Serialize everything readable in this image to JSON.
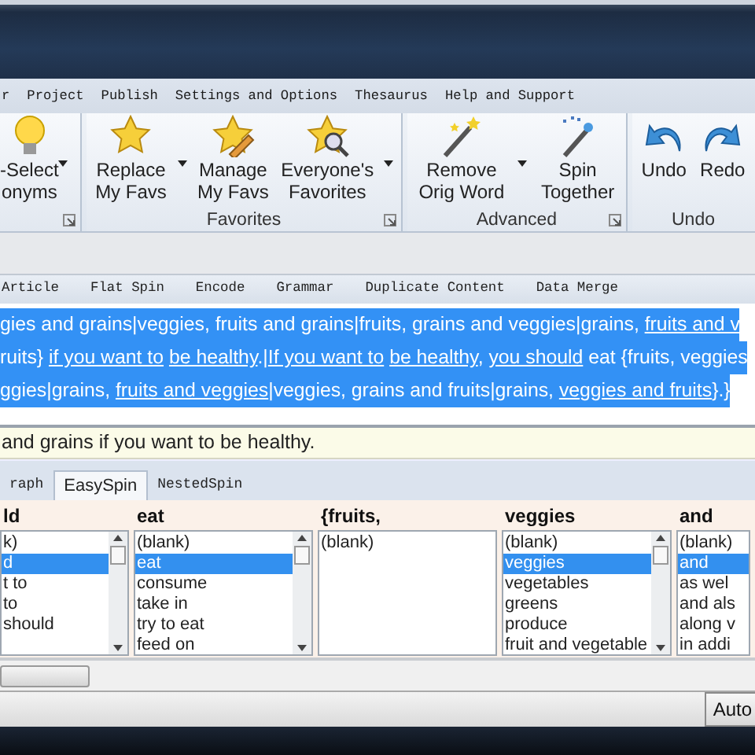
{
  "menu": [
    "r",
    "Project",
    "Publish",
    "Settings and Options",
    "Thesaurus",
    "Help and Support"
  ],
  "ribbon": [
    {
      "launcher": true,
      "buttons": [
        {
          "kind": "bulb",
          "lines": [
            "-Select",
            "onyms"
          ],
          "dropdown": true
        }
      ]
    },
    {
      "label": "Favorites",
      "launcher": true,
      "buttons": [
        {
          "kind": "star",
          "lines": [
            "Replace",
            "My Favs"
          ],
          "dropdown": true
        },
        {
          "kind": "starpencil",
          "lines": [
            "Manage",
            "My Favs"
          ],
          "dropdown": false
        },
        {
          "kind": "starsearch",
          "lines": [
            "Everyone's",
            "Favorites"
          ],
          "dropdown": true
        }
      ]
    },
    {
      "label": "Advanced",
      "launcher": true,
      "buttons": [
        {
          "kind": "wand",
          "lines": [
            "Remove",
            "Orig Word"
          ],
          "dropdown": true
        },
        {
          "kind": "wandsparkle",
          "lines": [
            "Spin",
            "Together"
          ],
          "dropdown": false
        }
      ]
    },
    {
      "label": "Undo",
      "launcher": false,
      "buttons": [
        {
          "kind": "undo",
          "lines": [
            "Undo"
          ],
          "dropdown": false
        },
        {
          "kind": "redo",
          "lines": [
            "Redo"
          ],
          "dropdown": false
        }
      ]
    }
  ],
  "tabs": [
    "Article",
    "Flat Spin",
    "Encode",
    "Grammar",
    "Duplicate Content",
    "Data Merge"
  ],
  "editor": {
    "selected": true,
    "lines": [
      [
        {
          "text": "gies and grains|veggies, fruits and grains|fruits, grains and veggies|grains, ",
          "underlined": false
        },
        {
          "text": "fruits and v",
          "underlined": true
        }
      ],
      [
        {
          "text": "ruits} ",
          "underlined": false
        },
        {
          "text": "if you want to ",
          "underlined": true
        },
        {
          "text": "be healthy",
          "underlined": true
        },
        {
          "text": ".|",
          "underlined": false
        },
        {
          "text": "If you want to ",
          "underlined": true
        },
        {
          "text": "be healthy",
          "underlined": true
        },
        {
          "text": ", ",
          "underlined": false
        },
        {
          "text": "you should",
          "underlined": true
        },
        {
          "text": " eat {fruits, veggies",
          "underlined": false
        }
      ],
      [
        {
          "text": "ggies|grains, ",
          "underlined": false
        },
        {
          "text": "fruits and veggies",
          "underlined": true
        },
        {
          "text": "|veggies, grains and fruits|grains, ",
          "underlined": false
        },
        {
          "text": "veggies and fruits",
          "underlined": true
        },
        {
          "text": "}.}",
          "underlined": false
        }
      ]
    ]
  },
  "preview": "and grains if you want to be healthy.",
  "spin_tabs": [
    {
      "label": "raph",
      "selected": false
    },
    {
      "label": "EasySpin",
      "selected": true
    },
    {
      "label": "NestedSpin",
      "selected": false
    }
  ],
  "columns": [
    {
      "heading": "ld",
      "scrollbar": true,
      "items": [
        {
          "text": "k)",
          "selected": false
        },
        {
          "text": "d",
          "selected": true
        },
        {
          "text": "t to",
          "selected": false
        },
        {
          "text": "to",
          "selected": false
        },
        {
          "text": "should",
          "selected": false
        }
      ]
    },
    {
      "heading": "eat",
      "scrollbar": true,
      "items": [
        {
          "text": "(blank)",
          "selected": false
        },
        {
          "text": "eat",
          "selected": true
        },
        {
          "text": "consume",
          "selected": false
        },
        {
          "text": "take in",
          "selected": false
        },
        {
          "text": "try to eat",
          "selected": false
        },
        {
          "text": "feed on",
          "selected": false
        }
      ]
    },
    {
      "heading": "{fruits,",
      "scrollbar": false,
      "items": [
        {
          "text": "(blank)",
          "selected": false
        }
      ]
    },
    {
      "heading": "veggies",
      "scrollbar": true,
      "items": [
        {
          "text": "(blank)",
          "selected": false
        },
        {
          "text": "veggies",
          "selected": true
        },
        {
          "text": "vegetables",
          "selected": false
        },
        {
          "text": "greens",
          "selected": false
        },
        {
          "text": "produce",
          "selected": false
        },
        {
          "text": "fruit and vegetable",
          "selected": false
        }
      ]
    },
    {
      "heading": "and",
      "scrollbar": false,
      "items": [
        {
          "text": "(blank)",
          "selected": false
        },
        {
          "text": "and",
          "selected": true
        },
        {
          "text": "as wel",
          "selected": false
        },
        {
          "text": "and als",
          "selected": false
        },
        {
          "text": "along v",
          "selected": false
        },
        {
          "text": "in addi",
          "selected": false
        }
      ]
    }
  ],
  "status_button": "Auto"
}
